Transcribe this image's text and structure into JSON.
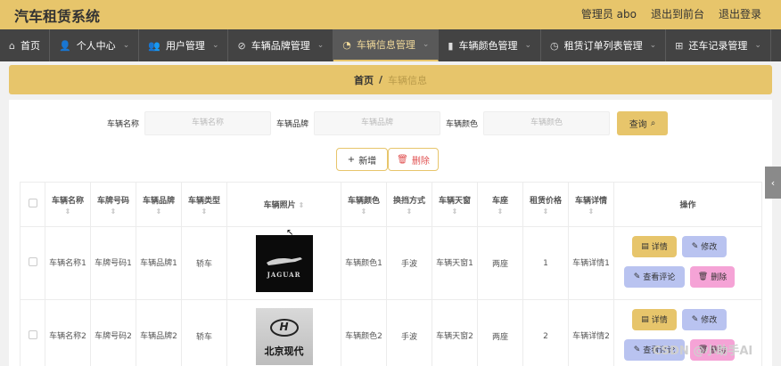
{
  "header": {
    "title": "汽车租赁系统",
    "admin": "管理员 abo",
    "back": "退出到前台",
    "logout": "退出登录"
  },
  "nav": [
    {
      "icon": "home-icon",
      "glyph": "⌂",
      "label": "首页",
      "active": false
    },
    {
      "icon": "user-icon",
      "glyph": "👤",
      "label": "个人中心",
      "active": false
    },
    {
      "icon": "users-icon",
      "glyph": "👥",
      "label": "用户管理",
      "active": false
    },
    {
      "icon": "tag-icon",
      "glyph": "⊘",
      "label": "车辆品牌管理",
      "active": false
    },
    {
      "icon": "dashboard-icon",
      "glyph": "◔",
      "label": "车辆信息管理",
      "active": true
    },
    {
      "icon": "bar-chart-icon",
      "glyph": "▮",
      "label": "车辆颜色管理",
      "active": false
    },
    {
      "icon": "clock-icon",
      "glyph": "◷",
      "label": "租赁订单列表管理",
      "active": false
    },
    {
      "icon": "grid-icon",
      "glyph": "⊞",
      "label": "还车记录管理",
      "active": false
    }
  ],
  "breadcrumb": {
    "home": "首页",
    "sep": "/",
    "current": "车辆信息"
  },
  "search": {
    "name_label": "车辆名称",
    "name_placeholder": "车辆名称",
    "brand_label": "车辆品牌",
    "brand_placeholder": "车辆品牌",
    "color_label": "车辆颜色",
    "color_placeholder": "车辆颜色",
    "query_label": "查询",
    "query_icon": "⌕"
  },
  "actions": {
    "add_label": "新增",
    "add_icon": "+",
    "delete_label": "删除",
    "delete_icon": "🗑"
  },
  "table": {
    "headers": [
      "车辆名称",
      "车牌号码",
      "车辆品牌",
      "车辆类型",
      "车辆照片",
      "车辆颜色",
      "换挡方式",
      "车辆天窗",
      "车座",
      "租赁价格",
      "车辆详情",
      "操作"
    ],
    "sort_glyph": "⇕",
    "rows": [
      {
        "name": "车辆名称1",
        "plate": "车牌号码1",
        "brand": "车辆品牌1",
        "type": "轿车",
        "photo": "jaguar",
        "photo_text": "JAGUAR",
        "color": "车辆颜色1",
        "gear": "手波",
        "sunroof": "车辆天窗1",
        "seats": "两座",
        "price": "1",
        "detail": "车辆详情1"
      },
      {
        "name": "车辆名称2",
        "plate": "车牌号码2",
        "brand": "车辆品牌2",
        "type": "轿车",
        "photo": "hyundai",
        "photo_text": "北京现代",
        "color": "车辆颜色2",
        "gear": "手波",
        "sunroof": "车辆天窗2",
        "seats": "两座",
        "price": "2",
        "detail": "车辆详情2"
      }
    ],
    "ops": {
      "detail": "详情",
      "edit": "修改",
      "review": "查看评论",
      "delete": "删除"
    }
  },
  "side_tab": "‹",
  "watermark": "CSDN @小助手AI"
}
